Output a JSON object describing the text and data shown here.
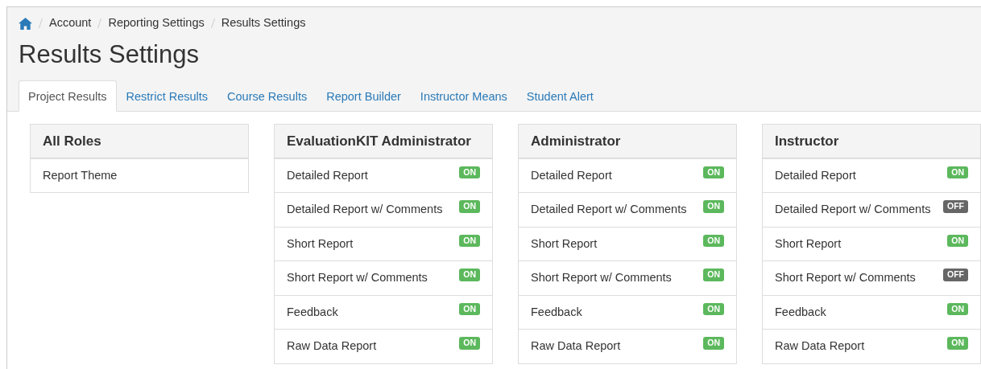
{
  "breadcrumb": [
    {
      "kind": "home"
    },
    {
      "label": "Account"
    },
    {
      "label": "Reporting Settings"
    },
    {
      "label": "Results Settings"
    }
  ],
  "title": "Results Settings",
  "tabs": [
    {
      "label": "Project Results",
      "selected": true
    },
    {
      "label": "Restrict Results",
      "selected": false
    },
    {
      "label": "Course Results",
      "selected": false
    },
    {
      "label": "Report Builder",
      "selected": false
    },
    {
      "label": "Instructor Means",
      "selected": false
    },
    {
      "label": "Student Alert",
      "selected": false
    }
  ],
  "panels": [
    {
      "title": "All Roles",
      "rows": [
        {
          "label": "Report Theme"
        }
      ]
    },
    {
      "title": "EvaluationKIT Administrator",
      "rows": [
        {
          "label": "Detailed Report",
          "status": "ON",
          "on": true
        },
        {
          "label": "Detailed Report w/ Comments",
          "status": "ON",
          "on": true
        },
        {
          "label": "Short Report",
          "status": "ON",
          "on": true
        },
        {
          "label": "Short Report w/ Comments",
          "status": "ON",
          "on": true
        },
        {
          "label": "Feedback",
          "status": "ON",
          "on": true
        },
        {
          "label": "Raw Data Report",
          "status": "ON",
          "on": true
        }
      ]
    },
    {
      "title": "Administrator",
      "rows": [
        {
          "label": "Detailed Report",
          "status": "ON",
          "on": true
        },
        {
          "label": "Detailed Report w/ Comments",
          "status": "ON",
          "on": true
        },
        {
          "label": "Short Report",
          "status": "ON",
          "on": true
        },
        {
          "label": "Short Report w/ Comments",
          "status": "ON",
          "on": true
        },
        {
          "label": "Feedback",
          "status": "ON",
          "on": true
        },
        {
          "label": "Raw Data Report",
          "status": "ON",
          "on": true
        }
      ]
    },
    {
      "title": "Instructor",
      "rows": [
        {
          "label": "Detailed Report",
          "status": "ON",
          "on": true
        },
        {
          "label": "Detailed Report w/ Comments",
          "status": "OFF",
          "on": false
        },
        {
          "label": "Short Report",
          "status": "ON",
          "on": true
        },
        {
          "label": "Short Report w/ Comments",
          "status": "OFF",
          "on": false
        },
        {
          "label": "Feedback",
          "status": "ON",
          "on": true
        },
        {
          "label": "Raw Data Report",
          "status": "ON",
          "on": true
        }
      ]
    }
  ]
}
